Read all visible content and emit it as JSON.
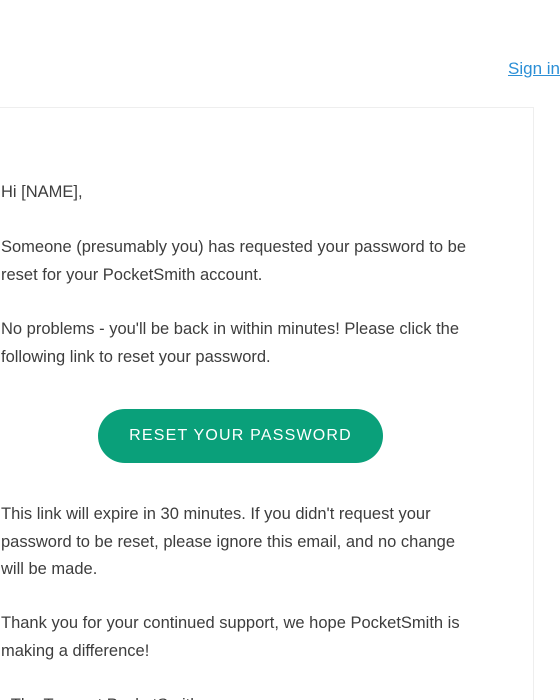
{
  "header": {
    "signin_label": "Sign in"
  },
  "email": {
    "greeting": "Hi [NAME],",
    "request_text": "Someone (presumably you) has requested your password to be reset for your PocketSmith account.",
    "no_problems_text": "No problems - you'll be back in within minutes! Please click the following link to reset your password.",
    "reset_button_label": "RESET YOUR PASSWORD",
    "expire_text": "This link will expire in 30 minutes. If you didn't request your password to be reset, please ignore this email, and no change will be made.",
    "thanks_text": "Thank you for your continued support, we hope PocketSmith is making a difference!",
    "signoff": "- The Team at PocketSmith"
  },
  "colors": {
    "accent": "#0aa07a",
    "link": "#2b8fd6",
    "text": "#3d3d3d"
  }
}
